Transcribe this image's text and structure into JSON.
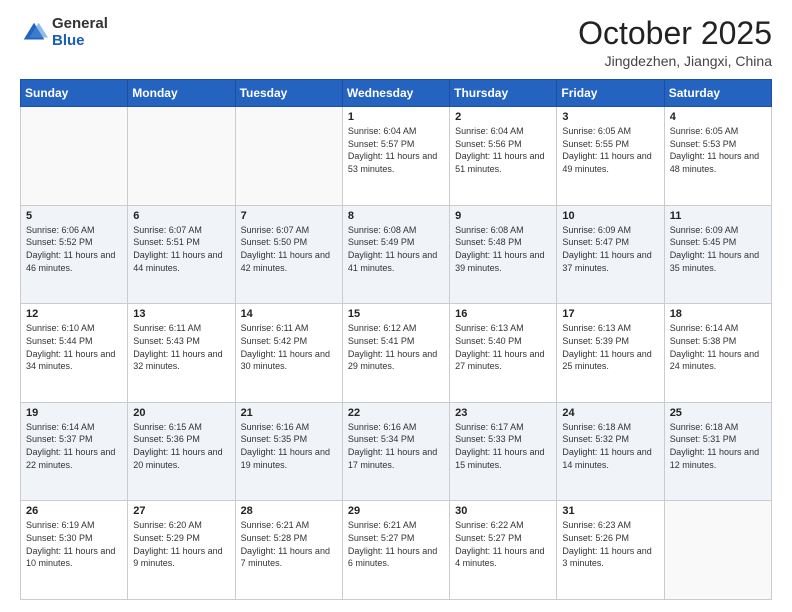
{
  "header": {
    "logo_general": "General",
    "logo_blue": "Blue",
    "month_title": "October 2025",
    "location": "Jingdezhen, Jiangxi, China"
  },
  "days_of_week": [
    "Sunday",
    "Monday",
    "Tuesday",
    "Wednesday",
    "Thursday",
    "Friday",
    "Saturday"
  ],
  "weeks": [
    [
      {
        "day": "",
        "info": ""
      },
      {
        "day": "",
        "info": ""
      },
      {
        "day": "",
        "info": ""
      },
      {
        "day": "1",
        "info": "Sunrise: 6:04 AM\nSunset: 5:57 PM\nDaylight: 11 hours and 53 minutes."
      },
      {
        "day": "2",
        "info": "Sunrise: 6:04 AM\nSunset: 5:56 PM\nDaylight: 11 hours and 51 minutes."
      },
      {
        "day": "3",
        "info": "Sunrise: 6:05 AM\nSunset: 5:55 PM\nDaylight: 11 hours and 49 minutes."
      },
      {
        "day": "4",
        "info": "Sunrise: 6:05 AM\nSunset: 5:53 PM\nDaylight: 11 hours and 48 minutes."
      }
    ],
    [
      {
        "day": "5",
        "info": "Sunrise: 6:06 AM\nSunset: 5:52 PM\nDaylight: 11 hours and 46 minutes."
      },
      {
        "day": "6",
        "info": "Sunrise: 6:07 AM\nSunset: 5:51 PM\nDaylight: 11 hours and 44 minutes."
      },
      {
        "day": "7",
        "info": "Sunrise: 6:07 AM\nSunset: 5:50 PM\nDaylight: 11 hours and 42 minutes."
      },
      {
        "day": "8",
        "info": "Sunrise: 6:08 AM\nSunset: 5:49 PM\nDaylight: 11 hours and 41 minutes."
      },
      {
        "day": "9",
        "info": "Sunrise: 6:08 AM\nSunset: 5:48 PM\nDaylight: 11 hours and 39 minutes."
      },
      {
        "day": "10",
        "info": "Sunrise: 6:09 AM\nSunset: 5:47 PM\nDaylight: 11 hours and 37 minutes."
      },
      {
        "day": "11",
        "info": "Sunrise: 6:09 AM\nSunset: 5:45 PM\nDaylight: 11 hours and 35 minutes."
      }
    ],
    [
      {
        "day": "12",
        "info": "Sunrise: 6:10 AM\nSunset: 5:44 PM\nDaylight: 11 hours and 34 minutes."
      },
      {
        "day": "13",
        "info": "Sunrise: 6:11 AM\nSunset: 5:43 PM\nDaylight: 11 hours and 32 minutes."
      },
      {
        "day": "14",
        "info": "Sunrise: 6:11 AM\nSunset: 5:42 PM\nDaylight: 11 hours and 30 minutes."
      },
      {
        "day": "15",
        "info": "Sunrise: 6:12 AM\nSunset: 5:41 PM\nDaylight: 11 hours and 29 minutes."
      },
      {
        "day": "16",
        "info": "Sunrise: 6:13 AM\nSunset: 5:40 PM\nDaylight: 11 hours and 27 minutes."
      },
      {
        "day": "17",
        "info": "Sunrise: 6:13 AM\nSunset: 5:39 PM\nDaylight: 11 hours and 25 minutes."
      },
      {
        "day": "18",
        "info": "Sunrise: 6:14 AM\nSunset: 5:38 PM\nDaylight: 11 hours and 24 minutes."
      }
    ],
    [
      {
        "day": "19",
        "info": "Sunrise: 6:14 AM\nSunset: 5:37 PM\nDaylight: 11 hours and 22 minutes."
      },
      {
        "day": "20",
        "info": "Sunrise: 6:15 AM\nSunset: 5:36 PM\nDaylight: 11 hours and 20 minutes."
      },
      {
        "day": "21",
        "info": "Sunrise: 6:16 AM\nSunset: 5:35 PM\nDaylight: 11 hours and 19 minutes."
      },
      {
        "day": "22",
        "info": "Sunrise: 6:16 AM\nSunset: 5:34 PM\nDaylight: 11 hours and 17 minutes."
      },
      {
        "day": "23",
        "info": "Sunrise: 6:17 AM\nSunset: 5:33 PM\nDaylight: 11 hours and 15 minutes."
      },
      {
        "day": "24",
        "info": "Sunrise: 6:18 AM\nSunset: 5:32 PM\nDaylight: 11 hours and 14 minutes."
      },
      {
        "day": "25",
        "info": "Sunrise: 6:18 AM\nSunset: 5:31 PM\nDaylight: 11 hours and 12 minutes."
      }
    ],
    [
      {
        "day": "26",
        "info": "Sunrise: 6:19 AM\nSunset: 5:30 PM\nDaylight: 11 hours and 10 minutes."
      },
      {
        "day": "27",
        "info": "Sunrise: 6:20 AM\nSunset: 5:29 PM\nDaylight: 11 hours and 9 minutes."
      },
      {
        "day": "28",
        "info": "Sunrise: 6:21 AM\nSunset: 5:28 PM\nDaylight: 11 hours and 7 minutes."
      },
      {
        "day": "29",
        "info": "Sunrise: 6:21 AM\nSunset: 5:27 PM\nDaylight: 11 hours and 6 minutes."
      },
      {
        "day": "30",
        "info": "Sunrise: 6:22 AM\nSunset: 5:27 PM\nDaylight: 11 hours and 4 minutes."
      },
      {
        "day": "31",
        "info": "Sunrise: 6:23 AM\nSunset: 5:26 PM\nDaylight: 11 hours and 3 minutes."
      },
      {
        "day": "",
        "info": ""
      }
    ]
  ]
}
